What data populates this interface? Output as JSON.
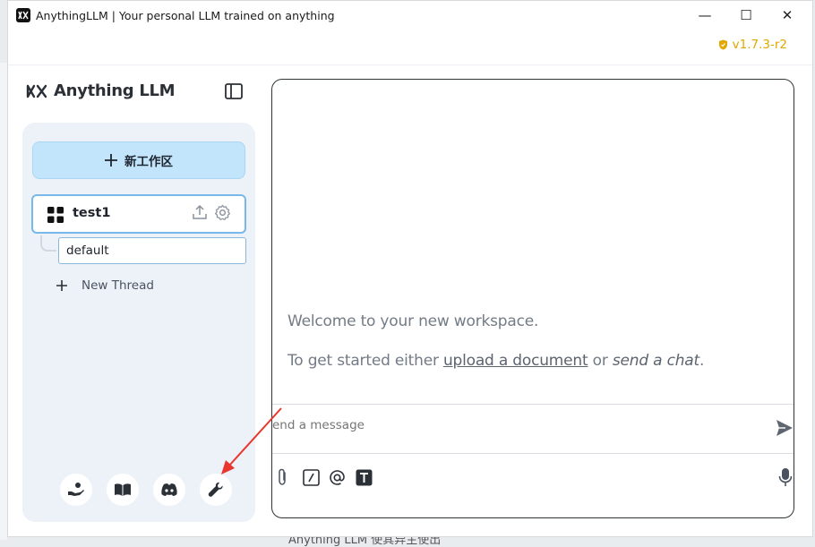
{
  "window": {
    "title": "AnythingLLM | Your personal LLM trained on anything",
    "minimize_glyph": "—",
    "maximize_glyph": "☐",
    "close_glyph": "✕"
  },
  "topbar": {
    "version": "v1.7.3-r2"
  },
  "sidebar": {
    "brand": "Anything LLM",
    "new_workspace_label": "新工作区",
    "workspace": {
      "name": "test1"
    },
    "thread_default": "default",
    "new_thread_label": "New Thread",
    "footer_icons": [
      "community-hand-icon",
      "docs-book-icon",
      "discord-icon",
      "settings-wrench-icon"
    ]
  },
  "chat": {
    "welcome": "Welcome to your new workspace.",
    "getstarted_prefix": "To get started either ",
    "upload_link": "upload a document",
    "or_text": " or ",
    "send_chat": "send a chat",
    "period": ".",
    "input_placeholder": "end a message"
  },
  "background_bottom_text": "Anything LLM 使其异主使出",
  "colors": {
    "accent": "#c2e5fb",
    "version": "#e0a800",
    "annotation_arrow": "#e8362f"
  }
}
